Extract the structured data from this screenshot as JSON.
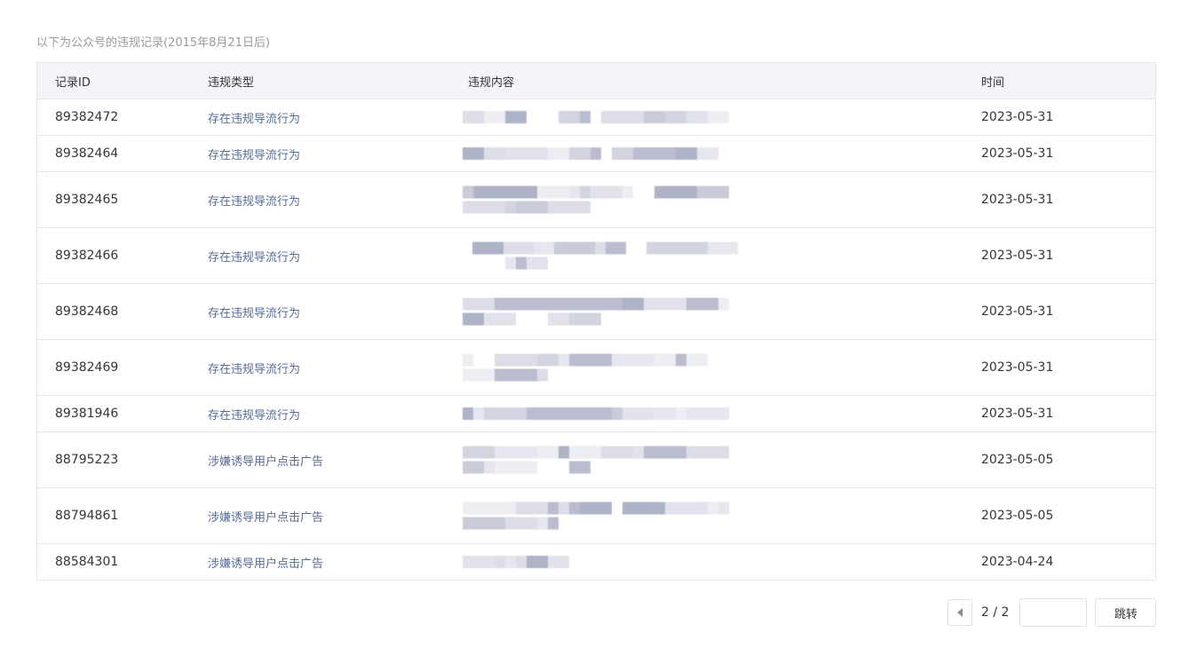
{
  "caption": "以下为公众号的违规记录(2015年8月21日后)",
  "table": {
    "headers": {
      "id": "记录ID",
      "type": "违规类型",
      "content": "违规内容",
      "time": "时间"
    },
    "rows": [
      {
        "id": "89382472",
        "type": "存在违规导流行为",
        "time": "2023-05-31",
        "lines": 1
      },
      {
        "id": "89382464",
        "type": "存在违规导流行为",
        "time": "2023-05-31",
        "lines": 1
      },
      {
        "id": "89382465",
        "type": "存在违规导流行为",
        "time": "2023-05-31",
        "lines": 2
      },
      {
        "id": "89382466",
        "type": "存在违规导流行为",
        "time": "2023-05-31",
        "lines": 2
      },
      {
        "id": "89382468",
        "type": "存在违规导流行为",
        "time": "2023-05-31",
        "lines": 2
      },
      {
        "id": "89382469",
        "type": "存在违规导流行为",
        "time": "2023-05-31",
        "lines": 2
      },
      {
        "id": "89381946",
        "type": "存在违规导流行为",
        "time": "2023-05-31",
        "lines": 1
      },
      {
        "id": "88795223",
        "type": "涉嫌诱导用户点击广告",
        "time": "2023-05-05",
        "lines": 2
      },
      {
        "id": "88794861",
        "type": "涉嫌诱导用户点击广告",
        "time": "2023-05-05",
        "lines": 2
      },
      {
        "id": "88584301",
        "type": "涉嫌诱导用户点击广告",
        "time": "2023-04-24",
        "lines": 1
      }
    ]
  },
  "pager": {
    "page_indicator": "2 / 2",
    "input_value": "",
    "jump_label": "跳转"
  },
  "colors": {
    "link": "#576b95",
    "header_bg": "#f4f5f9",
    "border": "#e7e7eb"
  }
}
